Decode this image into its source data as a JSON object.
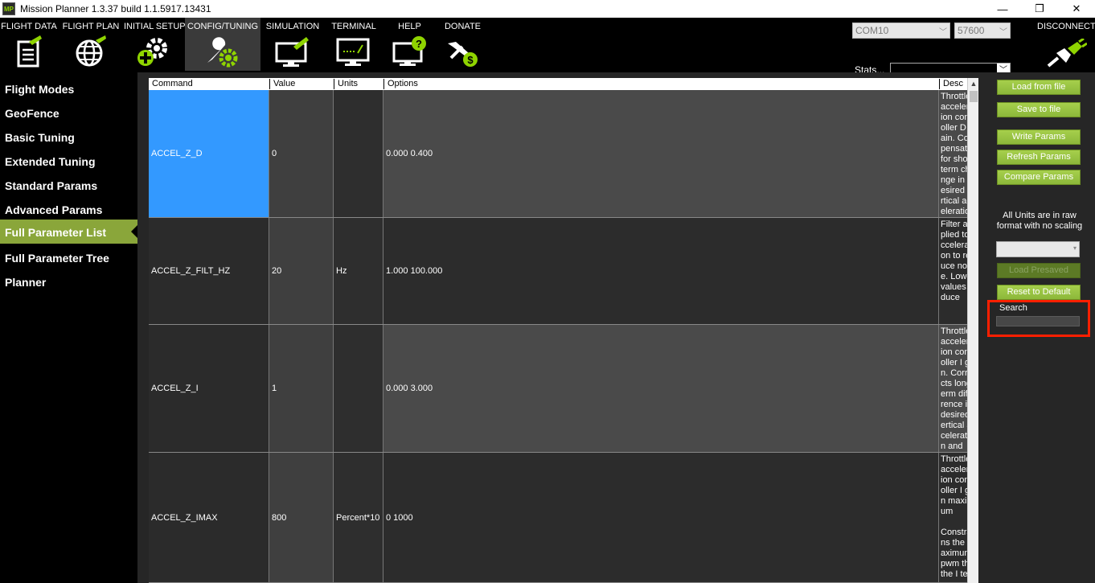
{
  "window": {
    "title": "Mission Planner 1.3.37 build 1.1.5917.13431",
    "app_icon": "MP",
    "minimize": "—",
    "maximize": "❐",
    "close": "✕"
  },
  "menu": {
    "items": [
      {
        "label": "FLIGHT DATA",
        "icon": "flight-data-icon"
      },
      {
        "label": "FLIGHT PLAN",
        "icon": "flight-plan-icon"
      },
      {
        "label": "INITIAL SETUP",
        "icon": "initial-setup-icon"
      },
      {
        "label": "CONFIG/TUNING",
        "icon": "config-tuning-icon",
        "active": true
      },
      {
        "label": "SIMULATION",
        "icon": "simulation-icon"
      },
      {
        "label": "TERMINAL",
        "icon": "terminal-icon"
      },
      {
        "label": "HELP",
        "icon": "help-icon"
      },
      {
        "label": "DONATE",
        "icon": "donate-icon"
      }
    ],
    "port": "COM10",
    "baud": "57600",
    "stats_link": "Stats...",
    "disconnect": "DISCONNECT"
  },
  "sidebar": {
    "items": [
      {
        "label": "Flight Modes"
      },
      {
        "label": "GeoFence"
      },
      {
        "label": "Basic Tuning"
      },
      {
        "label": "Extended Tuning"
      },
      {
        "label": "Standard Params"
      },
      {
        "label": "Advanced Params"
      },
      {
        "label": "Full Parameter List",
        "active": true
      },
      {
        "label": "Full Parameter Tree"
      },
      {
        "label": "Planner"
      }
    ]
  },
  "grid": {
    "columns": [
      "Command",
      "Value",
      "Units",
      "Options",
      "Desc"
    ],
    "rows": [
      {
        "command": "ACCEL_Z_D",
        "value": "0",
        "units": "",
        "options": "0.000 0.400",
        "desc": "Throttle acceleration controller D gain. Compensates for short-term change in desired vertical acceleration",
        "selected": true
      },
      {
        "command": "ACCEL_Z_FILT_HZ",
        "value": "20",
        "units": "Hz",
        "options": "1.000 100.000",
        "desc": "Filter applied to acceleration to reduce noise. Lower values reduce"
      },
      {
        "command": "ACCEL_Z_I",
        "value": "1",
        "units": "",
        "options": "0.000 3.000",
        "desc": "Throttle acceleration controller I gain. Corrects long-term difference in desired vertical acceleration and"
      },
      {
        "command": "ACCEL_Z_IMAX",
        "value": "800",
        "units": "Percent*10",
        "options": "0 1000",
        "desc": "Throttle acceleration controller I gain maximum\n\nConstrains the maximum pwm that the I term"
      }
    ]
  },
  "right_panel": {
    "load_from_file": "Load from file",
    "save_to_file": "Save to file",
    "write_params": "Write Params",
    "refresh_params": "Refresh Params",
    "compare_params": "Compare Params",
    "units_note": "All Units are in raw format with no scaling",
    "load_presaved": "Load Presaved",
    "reset_to_default": "Reset to Default",
    "search_label": "Search",
    "search_value": ""
  },
  "colors": {
    "selected_cell": "#3399ff",
    "accent_green": "#8aa63a",
    "highlight_box": "#ff1f00"
  }
}
